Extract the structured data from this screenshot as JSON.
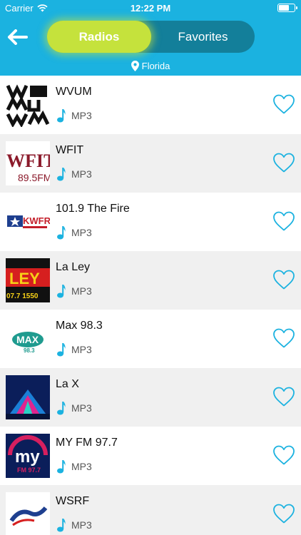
{
  "status_bar": {
    "carrier": "Carrier",
    "time": "12:22 PM"
  },
  "header": {
    "tabs": [
      {
        "label": "Radios",
        "active": true
      },
      {
        "label": "Favorites",
        "active": false
      }
    ],
    "location": "Florida"
  },
  "colors": {
    "header_bg": "#1bb2e0",
    "active_tab": "#c5e23c",
    "accent": "#1bb2e0"
  },
  "stations": [
    {
      "name": "WVUM",
      "format": "MP3"
    },
    {
      "name": "WFIT",
      "format": "MP3"
    },
    {
      "name": "101.9 The Fire",
      "format": "MP3"
    },
    {
      "name": "La Ley",
      "format": "MP3"
    },
    {
      "name": "Max 98.3",
      "format": "MP3"
    },
    {
      "name": "La X",
      "format": "MP3"
    },
    {
      "name": "MY FM 97.7",
      "format": "MP3"
    },
    {
      "name": "WSRF",
      "format": "MP3"
    }
  ],
  "logos": {
    "wfit": {
      "big": "WFIT",
      "sub": "89.5FM"
    },
    "fire": {
      "text": "KWFR"
    },
    "laley": {
      "top": "LEY",
      "bottom": "07.7 1550"
    },
    "max": {
      "text": "MAX",
      "sub": "98.3"
    },
    "my": {
      "text": "my",
      "sub": "FM 97.7"
    }
  }
}
